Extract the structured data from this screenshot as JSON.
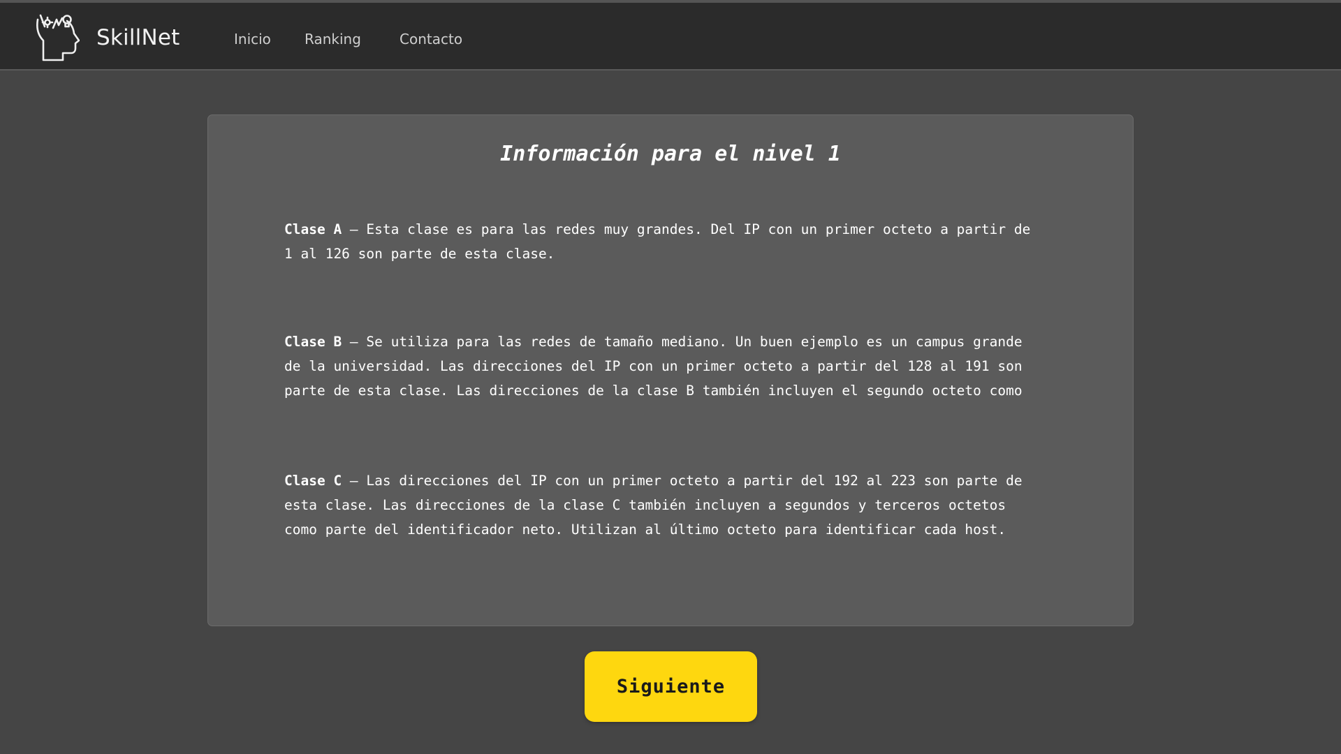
{
  "header": {
    "brand": "SkillNet",
    "nav": [
      {
        "label": "Inicio"
      },
      {
        "label": "Ranking"
      },
      {
        "label": "Contacto"
      }
    ]
  },
  "main": {
    "title": "Información para el nivel 1",
    "sections": [
      {
        "term": "Clase A",
        "text": " – Esta clase es para las redes muy grandes. Del IP con un primer octeto a partir de 1 al 126 son parte de esta clase."
      },
      {
        "term": "Clase B",
        "text": " – Se utiliza para las redes de tamaño mediano. Un buen ejemplo es un campus grande de la universidad. Las direcciones del IP con un primer octeto a partir del 128 al 191 son parte de esta clase. Las direcciones de la clase B también incluyen el segundo octeto como"
      },
      {
        "term": "Clase C",
        "text": " – Las direcciones del IP con un primer octeto a partir del 192 al 223 son parte de esta clase. Las direcciones de la clase C también incluyen a segundos y terceros octetos como parte del identificador neto. Utilizan al último octeto para identificar cada host."
      }
    ],
    "next_label": "Siguiente"
  },
  "icons": {
    "logo": "head-with-ideas-icon"
  },
  "colors": {
    "background": "#454545",
    "header": "#2b2b2b",
    "card": "#5b5b5b",
    "button": "#fed70f"
  }
}
